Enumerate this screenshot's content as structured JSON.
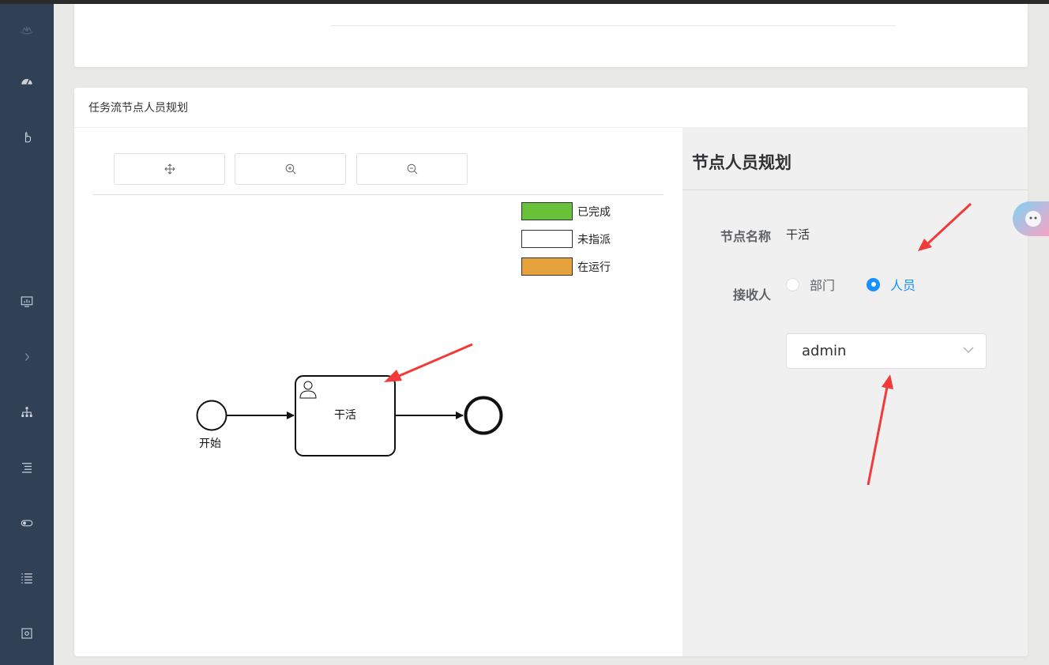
{
  "card": {
    "title": "任务流节点人员规划"
  },
  "toolbar": {
    "buttons": [
      {
        "icon": "move-icon"
      },
      {
        "icon": "zoom-in-icon"
      },
      {
        "icon": "zoom-out-icon"
      }
    ]
  },
  "legend": [
    {
      "label": "已完成",
      "color": "#67c23a"
    },
    {
      "label": "未指派",
      "color": "#ffffff"
    },
    {
      "label": "在运行",
      "color": "#e6a23c"
    }
  ],
  "diagram": {
    "start_label": "开始",
    "task_label": "干活"
  },
  "panel": {
    "title": "节点人员规划",
    "node_name_label": "节点名称",
    "node_name_value": "干活",
    "receiver_label": "接收人",
    "options": [
      {
        "label": "部门",
        "checked": false
      },
      {
        "label": "人员",
        "checked": true
      }
    ],
    "select_value": "admin"
  },
  "colors": {
    "sidebar": "#304156",
    "accent": "#1890ff",
    "annotation": "#f23a3a"
  }
}
